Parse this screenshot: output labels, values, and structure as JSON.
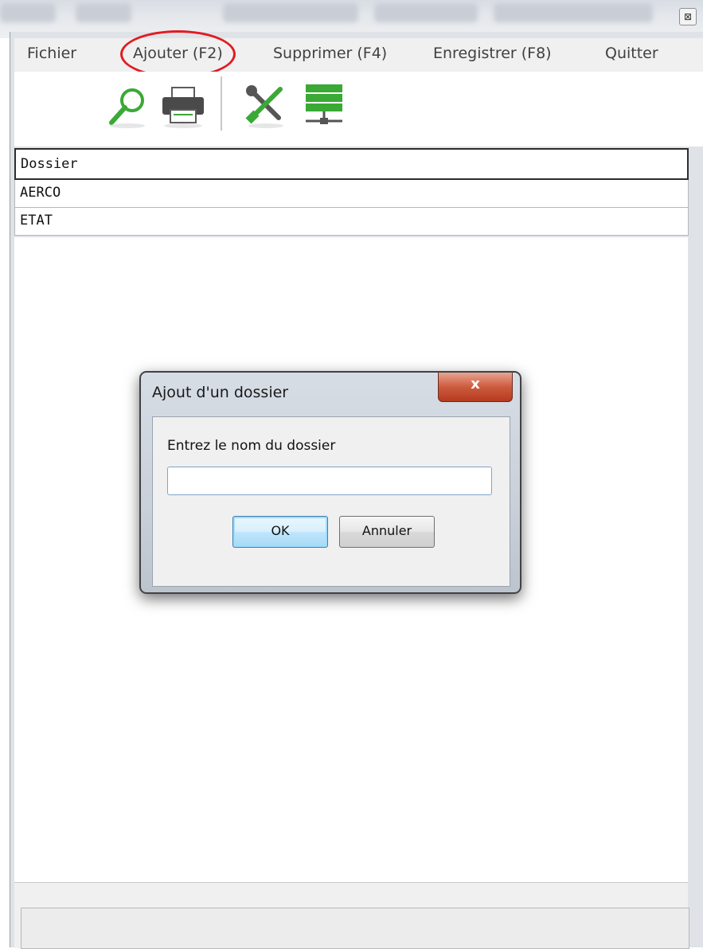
{
  "window": {
    "close_glyph": "⊠"
  },
  "menu": {
    "items": [
      "Fichier",
      "Ajouter (F2)",
      "Supprimer (F4)",
      "Enregistrer (F8)",
      "Quitter"
    ],
    "highlight_color": "#e11b22"
  },
  "toolbar": {
    "icons": [
      "search-icon",
      "printer-icon",
      "tools-icon",
      "database-server-icon"
    ],
    "accent": "#3aa935"
  },
  "grid": {
    "header": "Dossier",
    "rows": [
      "AERCO",
      "ETAT"
    ]
  },
  "dialog": {
    "title": "Ajout d'un dossier",
    "close_label": "x",
    "prompt": "Entrez le nom du dossier",
    "input_value": "",
    "ok_label": "OK",
    "cancel_label": "Annuler"
  }
}
